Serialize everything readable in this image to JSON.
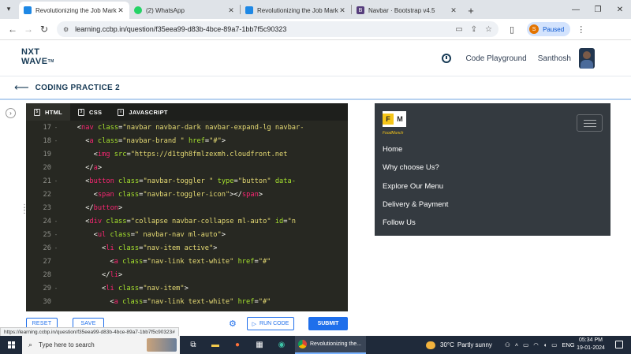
{
  "browser": {
    "tabs": [
      {
        "title": "Revolutionizing the Job Market",
        "icon": "ccbp-favicon",
        "color": "#1e88e5",
        "active": true
      },
      {
        "title": "(2) WhatsApp",
        "icon": "whatsapp-favicon",
        "color": "#25d366",
        "active": false
      },
      {
        "title": "Revolutionizing the Job Market",
        "icon": "ccbp-favicon",
        "color": "#1e88e5",
        "active": false
      },
      {
        "title": "Navbar · Bootstrap v4.5",
        "icon": "bootstrap-favicon",
        "color": "#563d7c",
        "active": false
      }
    ],
    "url": "learning.ccbp.in/question/f35eea99-d83b-4bce-89a7-1bb7f5c90323",
    "profile_initial": "S",
    "profile_status": "Paused"
  },
  "header": {
    "logo_line1": "NXT",
    "logo_line2": "WAVE",
    "logo_tm": "TM",
    "code_playground": "Code Playground",
    "user_name": "Santhosh"
  },
  "practice": {
    "title": "CODING PRACTICE 2"
  },
  "editor": {
    "tabs": [
      {
        "label": "HTML",
        "active": true
      },
      {
        "label": "CSS",
        "active": false
      },
      {
        "label": "JAVASCRIPT",
        "active": false
      }
    ],
    "lines": [
      {
        "num": "17",
        "fold": "-",
        "indent": 4,
        "html": "<span class=\"pun\">&lt;</span><span class=\"tag\">nav</span> <span class=\"attr\">class</span><span class=\"pun\">=</span><span class=\"str\">\"navbar navbar-dark navbar-expand-lg navbar-</span>"
      },
      {
        "num": "18",
        "fold": "-",
        "indent": 6,
        "html": "<span class=\"pun\">&lt;</span><span class=\"tag\">a</span> <span class=\"attr\">class</span><span class=\"pun\">=</span><span class=\"str\">\"navbar-brand \"</span> <span class=\"attr\">href</span><span class=\"pun\">=</span><span class=\"str\">\"#\"</span><span class=\"pun\">&gt;</span>"
      },
      {
        "num": "19",
        "fold": "",
        "indent": 8,
        "html": "<span class=\"pun\">&lt;</span><span class=\"tag\">img</span> <span class=\"attr\">src</span><span class=\"pun\">=</span><span class=\"str\">\"https://d1tgh8fmlzexmh.cloudfront.net</span>"
      },
      {
        "num": "20",
        "fold": "",
        "indent": 6,
        "html": "<span class=\"pun\">&lt;/</span><span class=\"tag\">a</span><span class=\"pun\">&gt;</span>"
      },
      {
        "num": "21",
        "fold": "-",
        "indent": 6,
        "html": "<span class=\"pun\">&lt;</span><span class=\"tag\">button</span> <span class=\"attr\">class</span><span class=\"pun\">=</span><span class=\"str\">\"navbar-toggler \"</span> <span class=\"attr\">type</span><span class=\"pun\">=</span><span class=\"str\">\"button\"</span> <span class=\"attr\">data-</span>"
      },
      {
        "num": "22",
        "fold": "",
        "indent": 8,
        "html": "<span class=\"pun\">&lt;</span><span class=\"tag\">span</span> <span class=\"attr\">class</span><span class=\"pun\">=</span><span class=\"str\">\"navbar-toggler-icon\"</span><span class=\"pun\">&gt;&lt;/</span><span class=\"tag\">span</span><span class=\"pun\">&gt;</span>"
      },
      {
        "num": "23",
        "fold": "",
        "indent": 6,
        "html": "<span class=\"pun\">&lt;/</span><span class=\"tag\">button</span><span class=\"pun\">&gt;</span>"
      },
      {
        "num": "24",
        "fold": "-",
        "indent": 6,
        "html": "<span class=\"pun\">&lt;</span><span class=\"tag\">div</span> <span class=\"attr\">class</span><span class=\"pun\">=</span><span class=\"str\">\"collapse navbar-collapse ml-auto\"</span> <span class=\"attr\">id</span><span class=\"pun\">=</span><span class=\"str\">\"n</span>"
      },
      {
        "num": "25",
        "fold": "-",
        "indent": 8,
        "html": "<span class=\"pun\">&lt;</span><span class=\"tag\">ul</span> <span class=\"attr\">class</span><span class=\"pun\">=</span><span class=\"str\">\" navbar-nav ml-auto\"</span><span class=\"pun\">&gt;</span>"
      },
      {
        "num": "26",
        "fold": "-",
        "indent": 10,
        "html": "<span class=\"pun\">&lt;</span><span class=\"tag\">li</span> <span class=\"attr\">class</span><span class=\"pun\">=</span><span class=\"str\">\"nav-item active\"</span><span class=\"pun\">&gt;</span>"
      },
      {
        "num": "27",
        "fold": "",
        "indent": 12,
        "html": "<span class=\"pun\">&lt;</span><span class=\"tag\">a</span> <span class=\"attr\">class</span><span class=\"pun\">=</span><span class=\"str\">\"nav-link text-white\"</span> <span class=\"attr\">href</span><span class=\"pun\">=</span><span class=\"str\">\"#\"</span>"
      },
      {
        "num": "28",
        "fold": "",
        "indent": 10,
        "html": "<span class=\"pun\">&lt;/</span><span class=\"tag\">li</span><span class=\"pun\">&gt;</span>"
      },
      {
        "num": "29",
        "fold": "-",
        "indent": 10,
        "html": "<span class=\"pun\">&lt;</span><span class=\"tag\">li</span> <span class=\"attr\">class</span><span class=\"pun\">=</span><span class=\"str\">\"nav-item\"</span><span class=\"pun\">&gt;</span>"
      },
      {
        "num": "30",
        "fold": "",
        "indent": 12,
        "html": "<span class=\"pun\">&lt;</span><span class=\"tag\">a</span> <span class=\"attr\">class</span><span class=\"pun\">=</span><span class=\"str\">\"nav-link text-white\"</span> <span class=\"attr\">href</span><span class=\"pun\">=</span><span class=\"str\">\"#\"</span>"
      }
    ],
    "reset_label": "RESET",
    "save_label": "SAVE",
    "run_label": "RUN CODE",
    "submit_label": "SUBMIT"
  },
  "preview": {
    "brand_letter1": "F",
    "brand_letter2": "M",
    "brand_sub": "FoodMunch",
    "nav_items": [
      "Home",
      "Why choose Us?",
      "Explore Our Menu",
      "Delivery & Payment",
      "Follow Us"
    ]
  },
  "status_url": "https://learning.ccbp.in/question/f35eea99-d83b-4bce-89a7-1bb7f5c90323#",
  "taskbar": {
    "search_placeholder": "Type here to search",
    "chrome_task_label": "Revolutionizing the...",
    "weather_temp": "30°C",
    "weather_desc": "Partly sunny",
    "language": "ENG",
    "time": "05:34 PM",
    "date": "19-01-2024"
  },
  "colors": {
    "accent": "#1f6feb",
    "brand_dark": "#183b56",
    "editor_bg": "#272822",
    "preview_bg": "#343a40"
  }
}
